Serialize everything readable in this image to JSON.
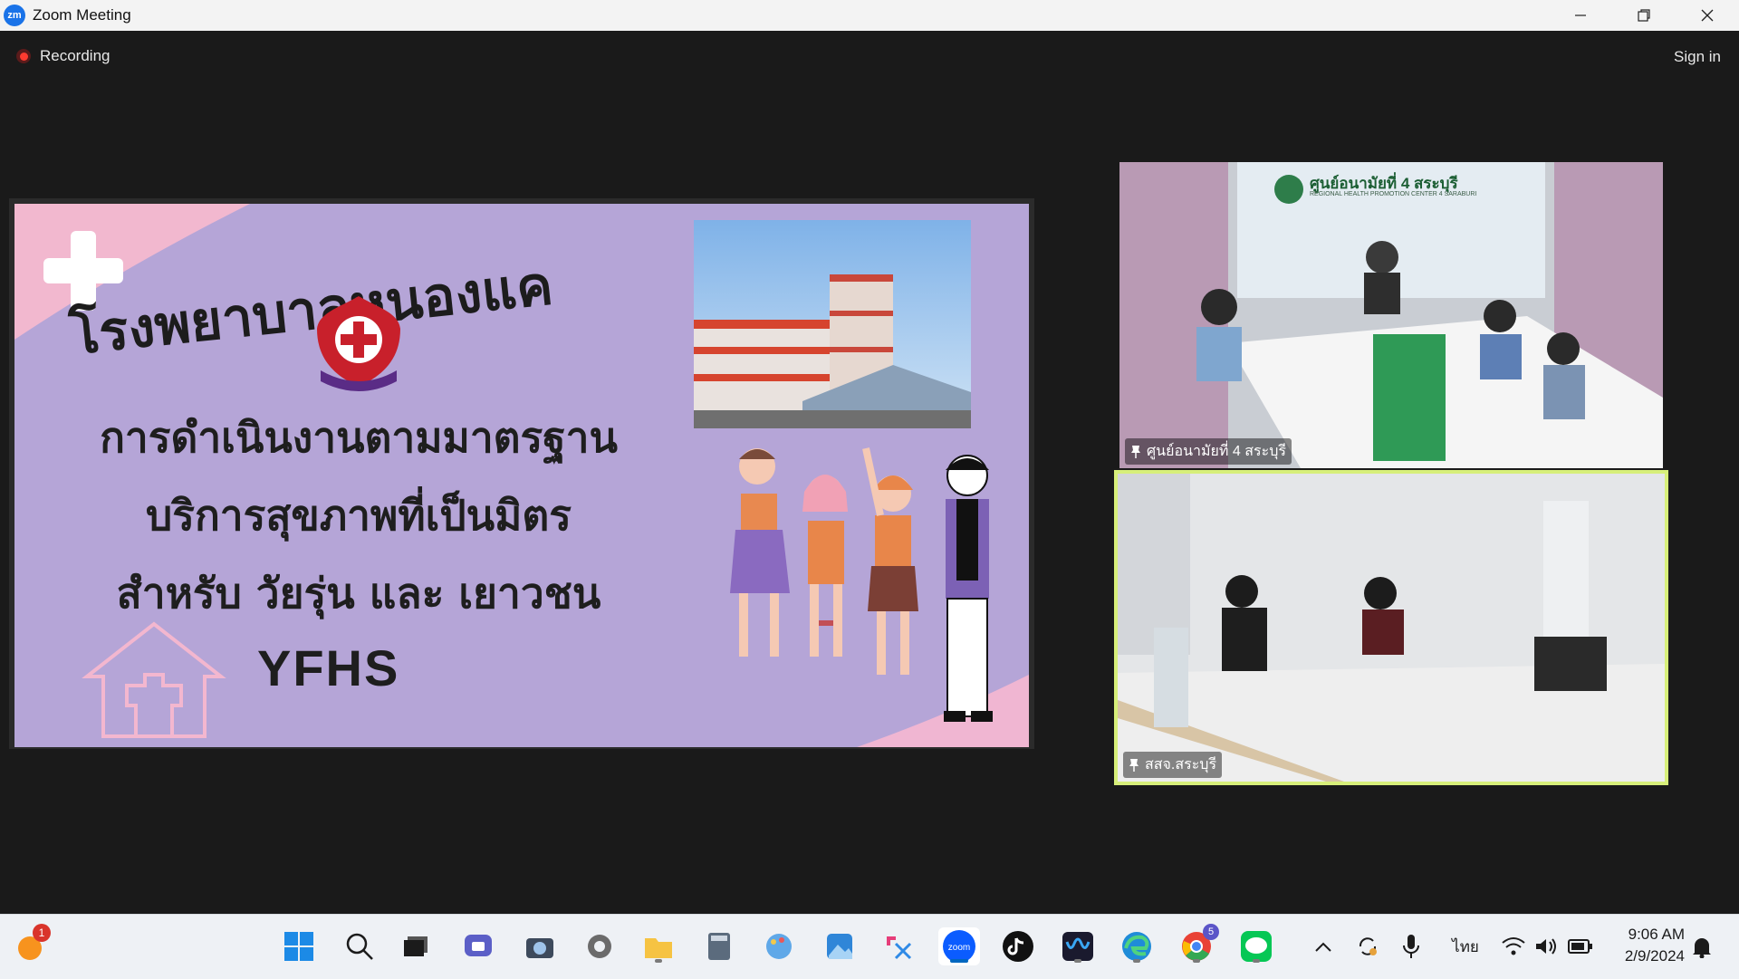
{
  "window": {
    "app_name": "Zoom Meeting",
    "logo_text": "zm"
  },
  "meeting": {
    "recording_label": "Recording",
    "signin_label": "Sign in"
  },
  "slide": {
    "hospital_name": "โรงพยาบาลหนองแค",
    "line1": "การดำเนินงานตามมาตรฐาน",
    "line2": "บริการสุขภาพที่เป็นมิตร",
    "line3": "สำหรับ วัยรุ่น และ เยาวชน",
    "acronym": "YFHS"
  },
  "participants": [
    {
      "name": "ศูนย์อนามัยที่ 4 สระบุรี",
      "banner_th": "ศูนย์อนามัยที่ 4 สระบุรี",
      "banner_en": "REGIONAL HEALTH PROMOTION CENTER 4 SARABURI"
    },
    {
      "name": "สสจ.สระบุรี"
    }
  ],
  "taskbar": {
    "chat_badge": "1",
    "chrome_badge": "5",
    "apps": [
      "start-icon",
      "search-icon",
      "task-view-icon",
      "teams-icon",
      "camera-icon",
      "settings-icon",
      "file-explorer-icon",
      "calculator-icon",
      "paint-icon",
      "photos-icon",
      "snipping-tool-icon",
      "zoom-icon",
      "tiktok-icon",
      "webex-icon",
      "edge-icon",
      "chrome-icon",
      "line-icon"
    ],
    "zoom_label": "zoom",
    "language": "ไทย",
    "time": "9:06 AM",
    "date": "2/9/2024"
  },
  "colors": {
    "slide_bg": "#b5a5d7",
    "active_speaker_border": "#d7ef7a",
    "zoom_blue": "#0b5cff",
    "recording_red": "#ff3b30"
  }
}
